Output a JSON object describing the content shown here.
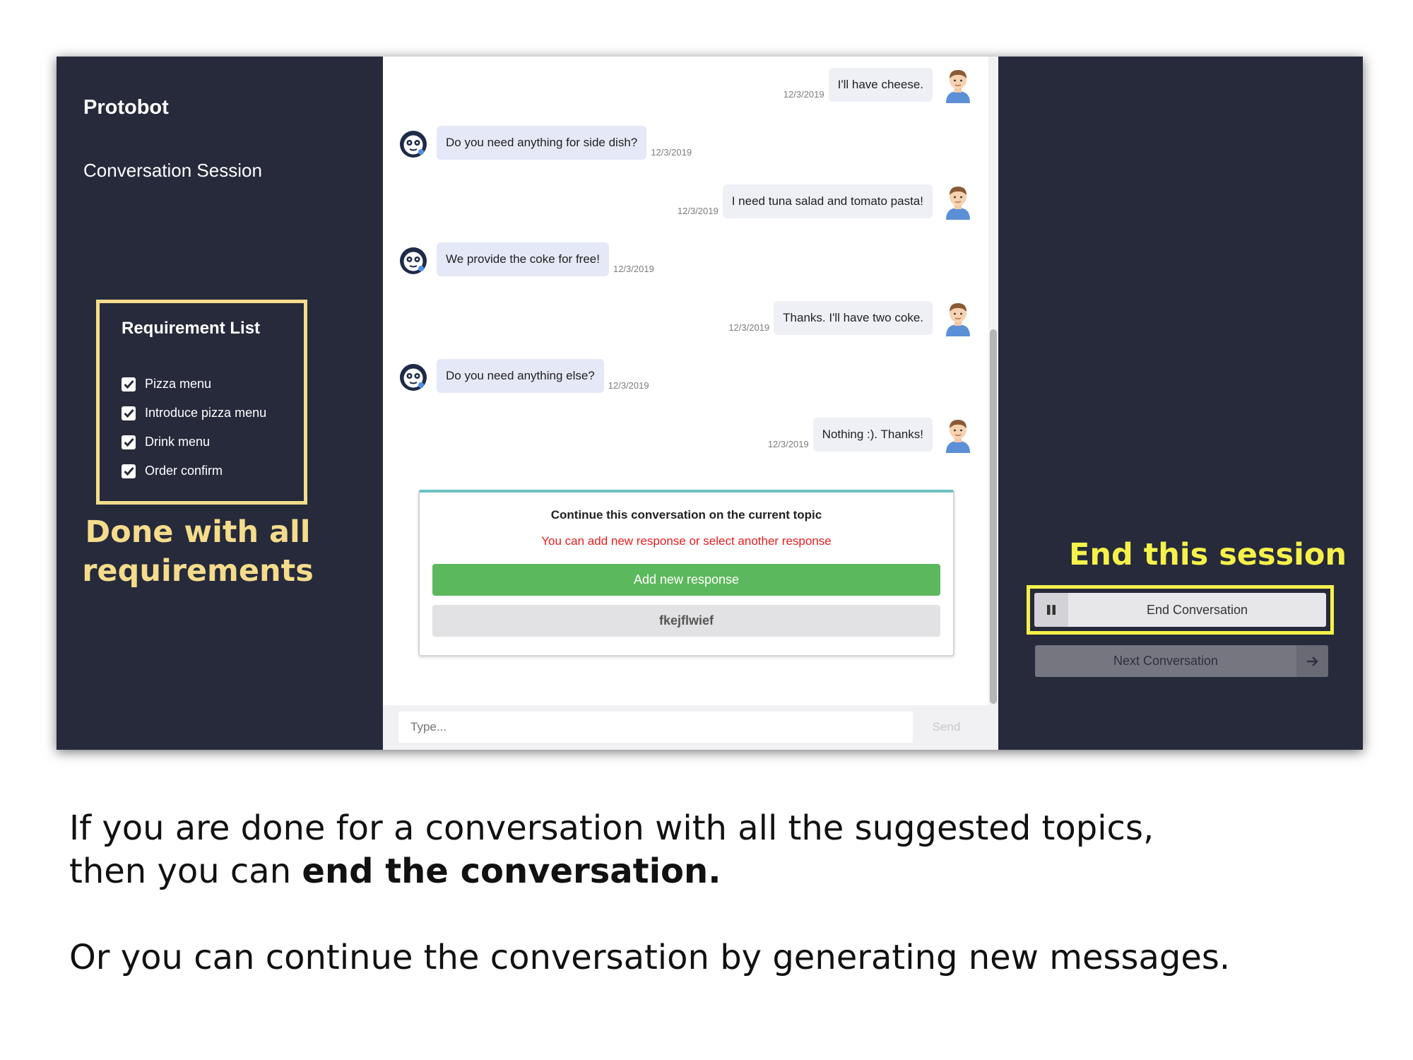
{
  "app": {
    "title": "Protobot",
    "session_title": "Conversation Session"
  },
  "requirements": {
    "title": "Requirement List",
    "items": [
      {
        "label": "Pizza menu",
        "checked": true
      },
      {
        "label": "Introduce pizza menu",
        "checked": true
      },
      {
        "label": "Drink menu",
        "checked": true
      },
      {
        "label": "Order confirm",
        "checked": true
      }
    ]
  },
  "annotations": {
    "left_line1": "Done with all",
    "left_line2": "requirements",
    "right": "End this session",
    "highlight_color": "#f5dc8c",
    "end_highlight_color": "#f6f14a"
  },
  "messages": [
    {
      "sender": "user",
      "text": "I'll have cheese.",
      "time": "12/3/2019"
    },
    {
      "sender": "bot",
      "text": "Do you need anything for side dish?",
      "time": "12/3/2019"
    },
    {
      "sender": "user",
      "text": "I need tuna salad and tomato pasta!",
      "time": "12/3/2019"
    },
    {
      "sender": "bot",
      "text": "We provide the coke for free!",
      "time": "12/3/2019"
    },
    {
      "sender": "user",
      "text": "Thanks. I'll have two coke.",
      "time": "12/3/2019"
    },
    {
      "sender": "bot",
      "text": "Do you need anything else?",
      "time": "12/3/2019"
    },
    {
      "sender": "user",
      "text": "Nothing :). Thanks!",
      "time": "12/3/2019"
    }
  ],
  "continue_panel": {
    "title": "Continue this conversation on the current topic",
    "subtitle": "You can add new response or select another response",
    "add_button": "Add new response",
    "response_option": "fkejflwief"
  },
  "input_bar": {
    "placeholder": "Type...",
    "send_label": "Send"
  },
  "controls": {
    "end_label": "End Conversation",
    "next_label": "Next Conversation"
  },
  "caption": {
    "line1": "If you are done for a conversation with all the suggested topics,",
    "line2_prefix": "then you can ",
    "line2_bold": "end the conversation.",
    "line3": "Or you can continue the conversation by generating new messages."
  },
  "colors": {
    "dark_bg": "#262a3b",
    "add_button": "#5cb85c",
    "subtitle_red": "#e81d1d"
  }
}
